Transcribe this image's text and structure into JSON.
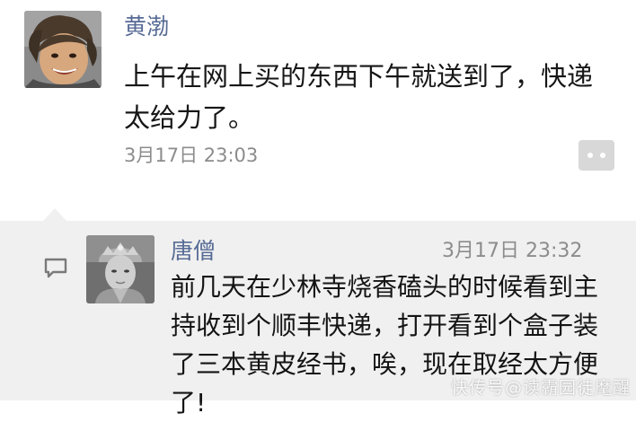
{
  "post": {
    "author": "黄渤",
    "text": "上午在网上买的东西下午就送到了，快递太给力了。",
    "time": "3月17日 23:03",
    "more_icon": "more-dots-icon"
  },
  "comment": {
    "icon": "comment-bubble-icon",
    "author": "唐僧",
    "time": "3月17日 23:32",
    "text": "前几天在少林寺烧香磕头的时候看到主持收到个顺丰快递，打开看到个盒子装了三本黄皮经书，唉，现在取经太方便了!"
  },
  "watermark": "快传号@读霸园徒麾醒",
  "colors": {
    "author_link": "#576b95",
    "timestamp": "#8c8c8c",
    "comment_background": "#f0f0f0",
    "more_button": "#d8d8d8"
  }
}
